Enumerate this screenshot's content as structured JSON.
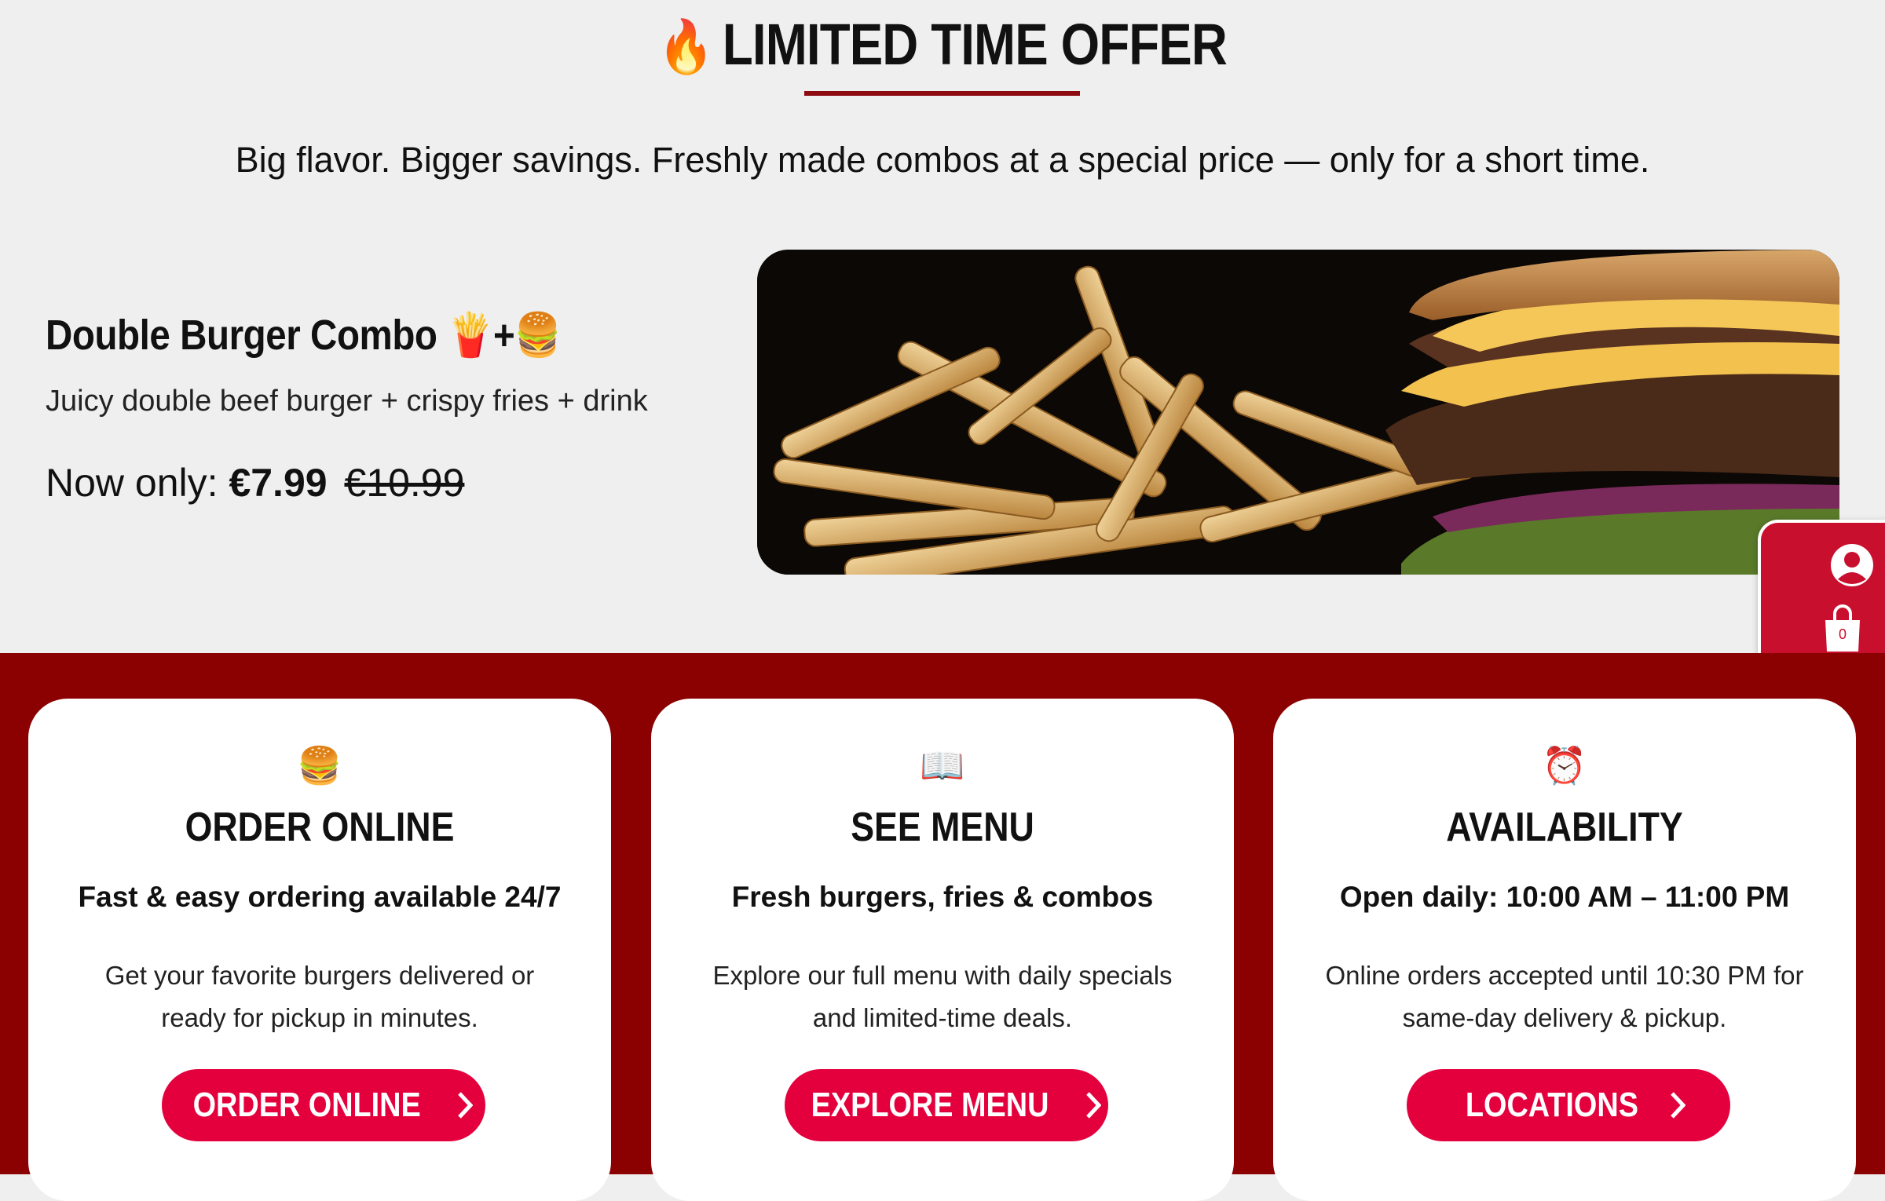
{
  "offer": {
    "icon": "fire-icon",
    "heading": "LIMITED TIME OFFER",
    "subheading": "Big flavor. Bigger savings. Freshly made combos at a special price — only for a short time.",
    "accent_color": "#8c0a10"
  },
  "combo": {
    "title": "Double Burger Combo",
    "title_emoji": "🍟+🍔",
    "description": "Juicy double beef burger + crispy fries + drink",
    "price_label": "Now only:",
    "price": "€7.99",
    "old_price": "€10.99",
    "image": "burger-and-fries-photo"
  },
  "side_widget": {
    "account_icon": "user-icon",
    "cart_icon": "shopping-bag-icon",
    "cart_count": "0",
    "color": "#c8102e"
  },
  "cards": [
    {
      "emoji": "🍔",
      "title": "ORDER ONLINE",
      "subtitle": "Fast & easy ordering available 24/7",
      "body": "Get your favorite burgers delivered or ready for pickup in minutes.",
      "cta": "ORDER ONLINE"
    },
    {
      "emoji": "📖",
      "title": "SEE MENU",
      "subtitle": "Fresh burgers, fries & combos",
      "body": "Explore our full menu with daily specials and limited-time deals.",
      "cta": "EXPLORE MENU"
    },
    {
      "emoji": "⏰",
      "title": "AVAILABILITY",
      "subtitle": "Open daily: 10:00 AM – 11:00 PM",
      "body": "Online orders accepted until 10:30 PM for same-day delivery & pickup.",
      "cta": "LOCATIONS"
    }
  ],
  "colors": {
    "band": "#8b0000",
    "cta": "#e4003d"
  }
}
